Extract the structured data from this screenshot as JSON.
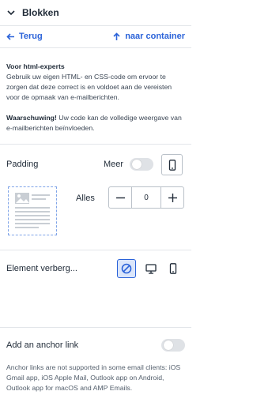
{
  "header": {
    "title": "Blokken"
  },
  "nav": {
    "back_label": "Terug",
    "container_label": "naar container"
  },
  "info": {
    "experts_title": "Voor html-experts",
    "experts_text": "Gebruik uw eigen HTML- en CSS-code om ervoor te zorgen dat deze correct is en voldoet aan de vereisten voor de opmaak van e-mailberichten.",
    "warning_title": "Waarschuwing!",
    "warning_text": " Uw code kan de volledige weergave van e-mailberichten beïnvloeden."
  },
  "padding": {
    "label": "Padding",
    "more_label": "Meer",
    "all_label": "Alles",
    "value": "0"
  },
  "visibility": {
    "label": "Element verberg..."
  },
  "anchor": {
    "label": "Add an anchor link",
    "note": "Anchor links are not supported in some email clients: iOS Gmail app, iOS Apple Mail, Outlook app on Android, Outlook app for macOS and AMP Emails."
  },
  "colors": {
    "accent": "#2b63d9",
    "toggle_off": "#dfe2e6",
    "border": "#b9c0c8"
  },
  "icons": [
    "chevron-down-icon",
    "arrow-left-icon",
    "arrow-up-icon",
    "mobile-icon",
    "image-placeholder-icon",
    "minus-icon",
    "plus-icon",
    "block-icon",
    "desktop-icon"
  ]
}
